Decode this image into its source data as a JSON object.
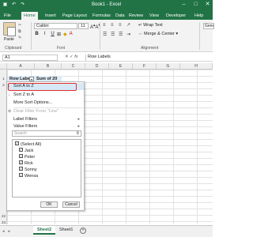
{
  "window": {
    "title": "Book1 - Excel"
  },
  "ribbon_tabs": [
    {
      "label": "File"
    },
    {
      "label": "Home"
    },
    {
      "label": "Insert"
    },
    {
      "label": "Page Layout"
    },
    {
      "label": "Formulas"
    },
    {
      "label": "Data"
    },
    {
      "label": "Review"
    },
    {
      "label": "View"
    },
    {
      "label": "Developer"
    },
    {
      "label": "Help"
    }
  ],
  "ribbon": {
    "paste_label": "Paste",
    "clipboard_label": "Clipboard",
    "font_name": "Calibri",
    "font_size": "11",
    "font_label": "Font",
    "bold": "B",
    "italic": "I",
    "underline": "U",
    "wrap_text": "Wrap Text",
    "merge_center": "Merge & Center",
    "alignment_label": "Alignment",
    "number_format": "Gene"
  },
  "formula_bar": {
    "name_box": "A1",
    "content": "Row Labels",
    "fx": "fx"
  },
  "columns": [
    "A",
    "B",
    "C",
    "D",
    "E",
    "F",
    "G",
    "H"
  ],
  "rows": [
    "1",
    "2",
    "22",
    "23"
  ],
  "cells": {
    "a1": "Row Labels",
    "b1": "Sum of 20"
  },
  "filter_menu": {
    "sort_az": "Sort A to Z",
    "sort_za": "Sort Z to A",
    "more_sort": "More Sort Options...",
    "clear_filter": "Clear Filter From \"Line\"",
    "label_filters": "Label Filters",
    "value_filters": "Value Filters",
    "search_placeholder": "Search",
    "items": [
      {
        "label": "(Select All)"
      },
      {
        "label": "Jack"
      },
      {
        "label": "Peter"
      },
      {
        "label": "Rick"
      },
      {
        "label": "Sonny"
      },
      {
        "label": "Wensa"
      }
    ],
    "ok": "OK",
    "cancel": "Cancel"
  },
  "sheet_tabs": [
    {
      "label": "Sheet2"
    },
    {
      "label": "Sheet1"
    }
  ]
}
